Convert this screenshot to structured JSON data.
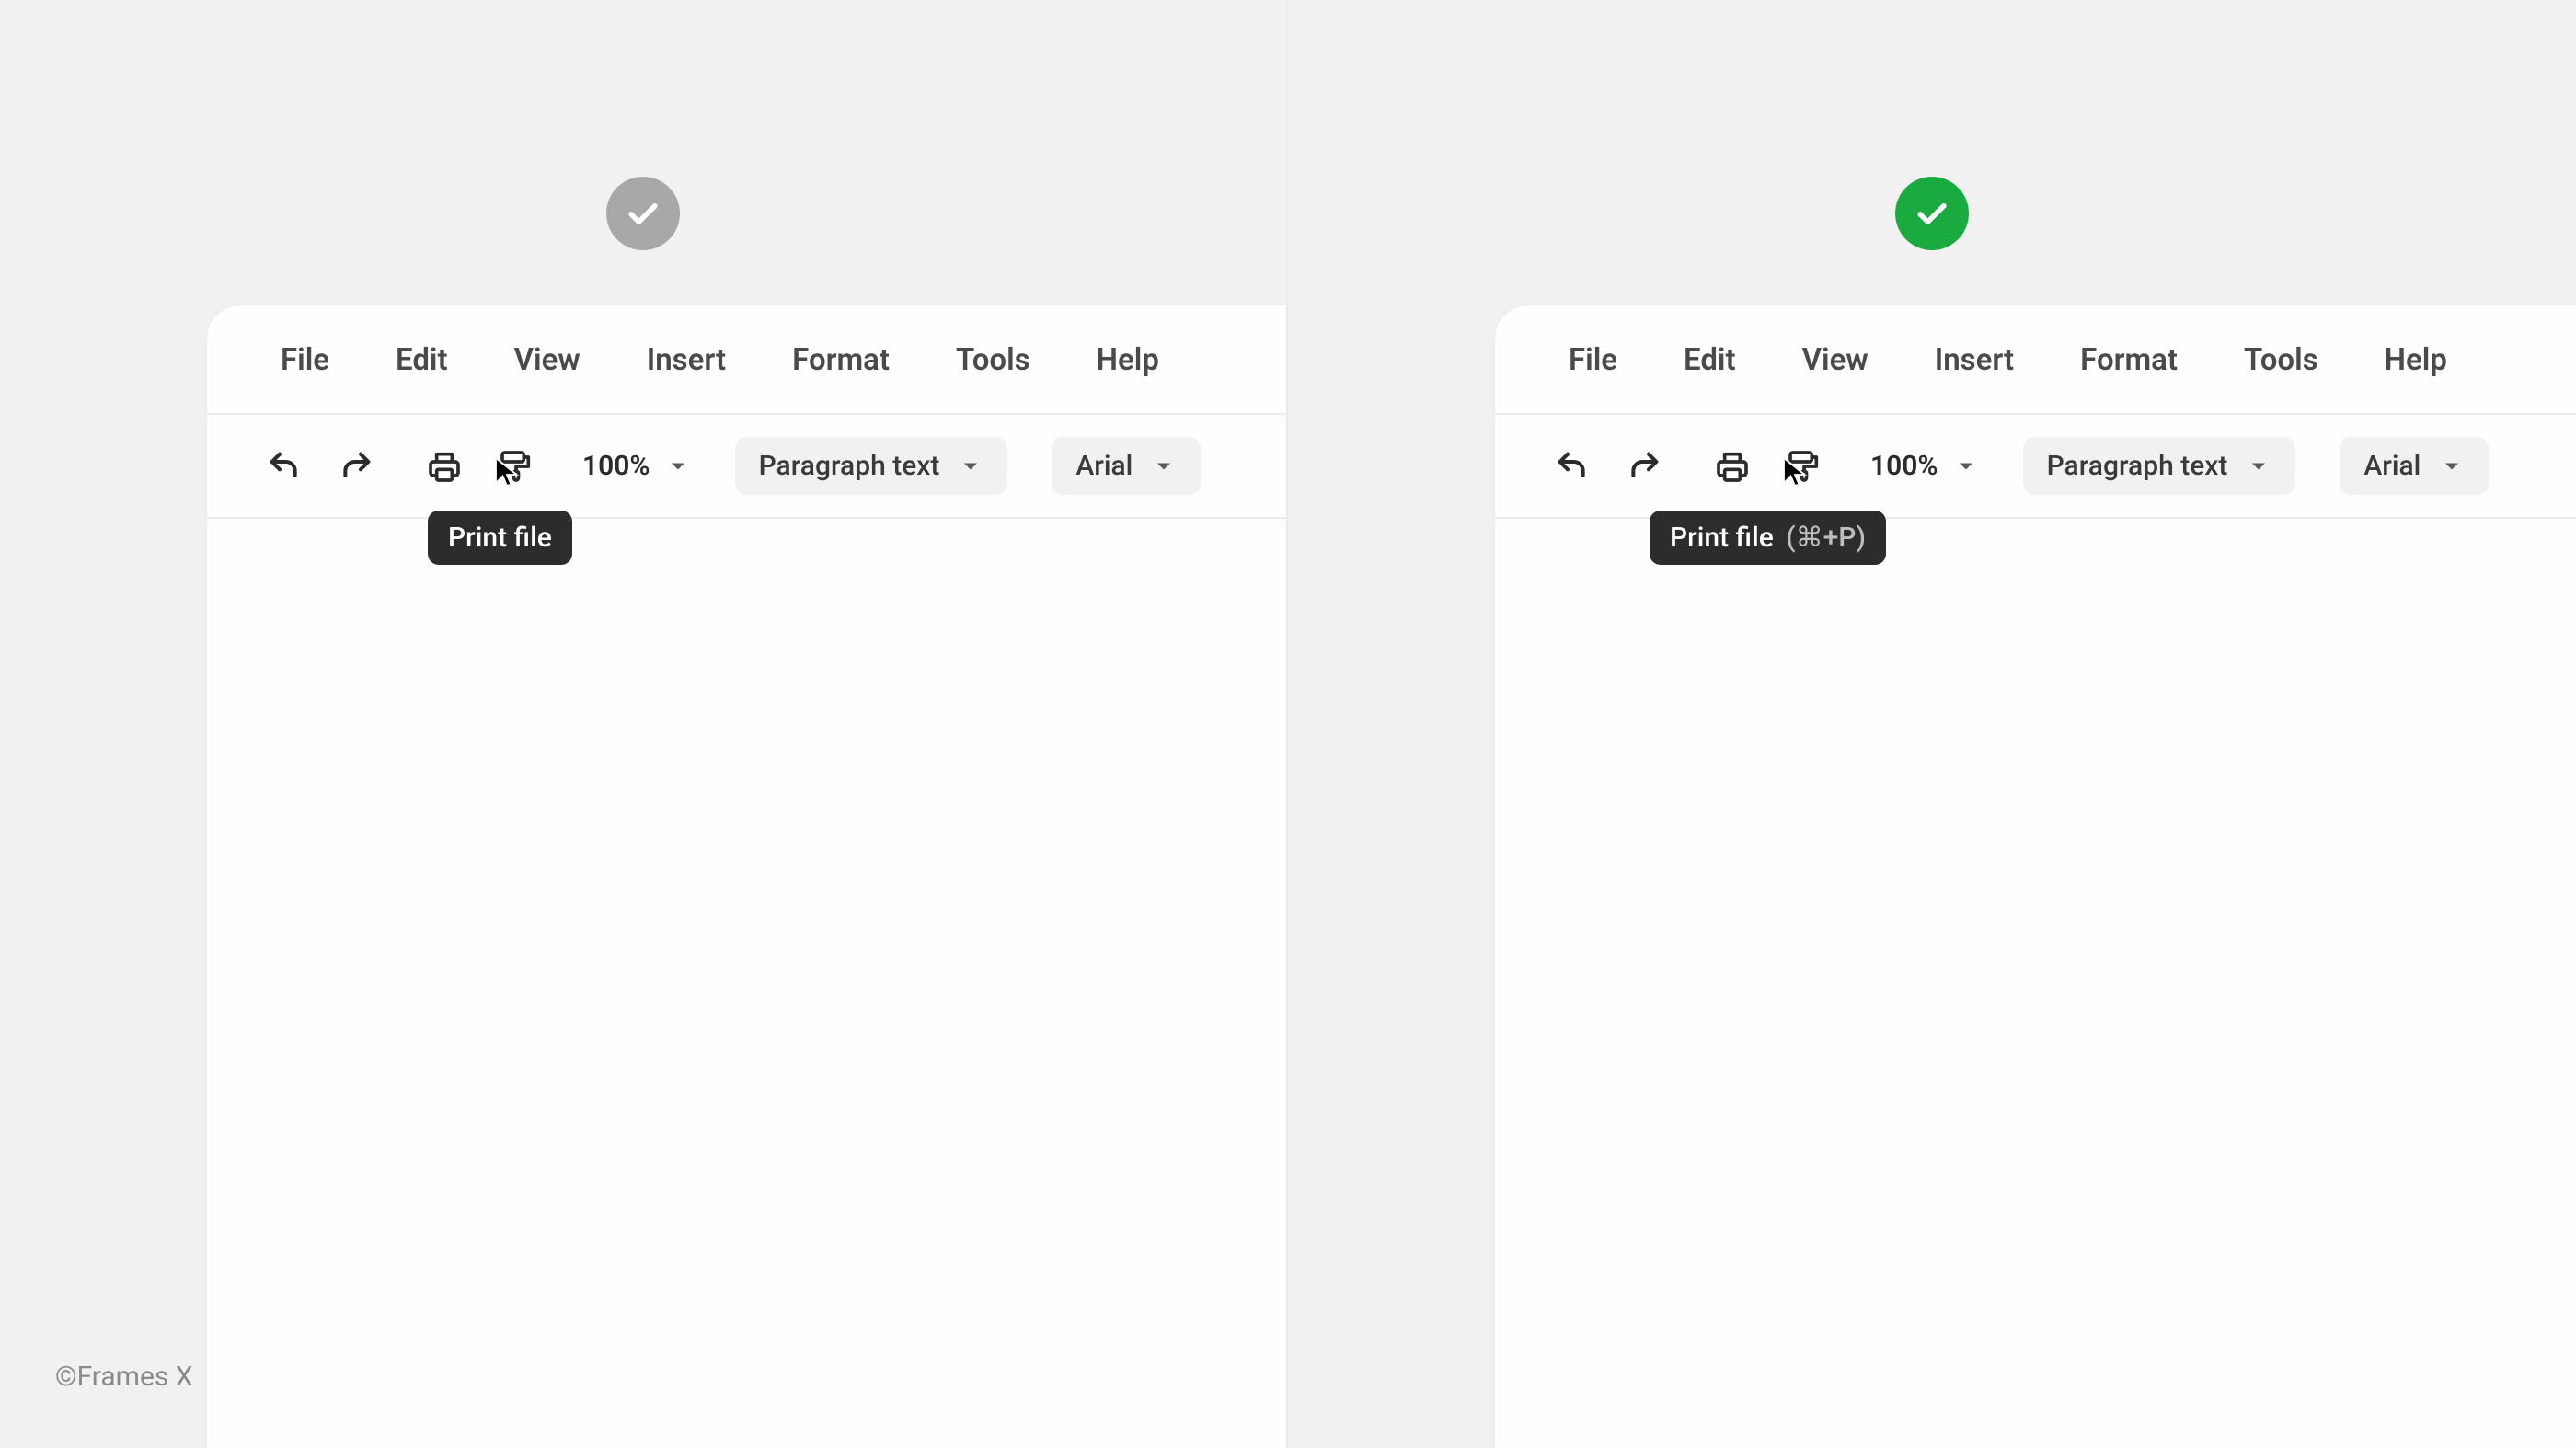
{
  "attribution": "©Frames X",
  "badge_left": {
    "state": "neutral"
  },
  "badge_right": {
    "state": "good"
  },
  "menubar": {
    "items": [
      "File",
      "Edit",
      "View",
      "Insert",
      "Format",
      "Tools",
      "Help"
    ]
  },
  "toolbar": {
    "zoom": "100%",
    "style_select": "Paragraph text",
    "font_select": "Arial"
  },
  "tooltip_left": {
    "label": "Print file",
    "shortcut": ""
  },
  "tooltip_right": {
    "label": "Print file",
    "shortcut": "(⌘+P)"
  }
}
